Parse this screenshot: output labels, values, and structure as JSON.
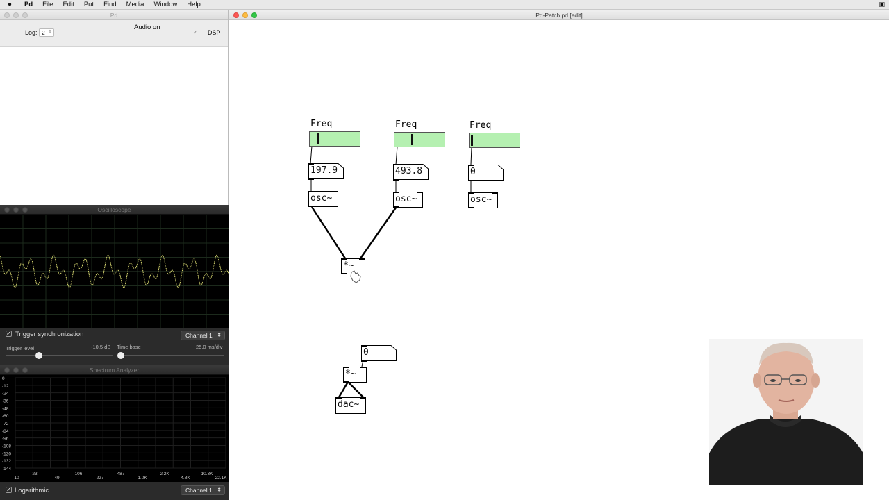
{
  "menubar": {
    "apple": "",
    "app": "Pd",
    "items": [
      "File",
      "Edit",
      "Put",
      "Find",
      "Media",
      "Window",
      "Help"
    ]
  },
  "pd_window": {
    "title": "Pd",
    "log_label": "Log:",
    "log_value": "2",
    "audio_status": "Audio on",
    "dsp_label": "DSP",
    "dsp_checked": "✓"
  },
  "oscilloscope": {
    "title": "Oscilloscope",
    "trigger_sync_label": "Trigger synchronization",
    "trigger_sync_checked": "✓",
    "channel": "Channel 1",
    "trigger_level_label": "Trigger level",
    "trigger_level_value": "-10.5 dB",
    "time_base_label": "Time base",
    "time_base_value": "25.0 ms/div",
    "trace_color": "#d8d870"
  },
  "spectrum": {
    "title": "Spectrum Analyzer",
    "db_ticks": [
      "0",
      "-12",
      "-24",
      "-36",
      "-48",
      "-60",
      "-72",
      "-84",
      "-96",
      "-108",
      "-120",
      "-132",
      "-144"
    ],
    "freq_ticks_low": [
      "10",
      "49",
      "227",
      "1.0K",
      "4.8K",
      "22.1K"
    ],
    "freq_ticks_high": [
      "23",
      "106",
      "487",
      "2.2K",
      "10.3K"
    ],
    "log_label": "Logarithmic",
    "log_checked": "✓",
    "channel": "Channel 1"
  },
  "patch": {
    "title": "Pd-Patch.pd [edit]",
    "comments": [
      "Freq",
      "Freq",
      "Freq"
    ],
    "sliders": [
      {
        "level": 0.13,
        "color": "#b5f0b1"
      },
      {
        "level": 0.34,
        "color": "#b5f0b1"
      },
      {
        "level": 0.0,
        "color": "#b5f0b1"
      }
    ],
    "numbers": [
      "197.9",
      "493.8",
      "0",
      "0"
    ],
    "objects": {
      "osc1": "osc~",
      "osc2": "osc~",
      "osc3": "osc~",
      "mul1": "*~",
      "mul2": "*~",
      "dac": "dac~"
    }
  }
}
